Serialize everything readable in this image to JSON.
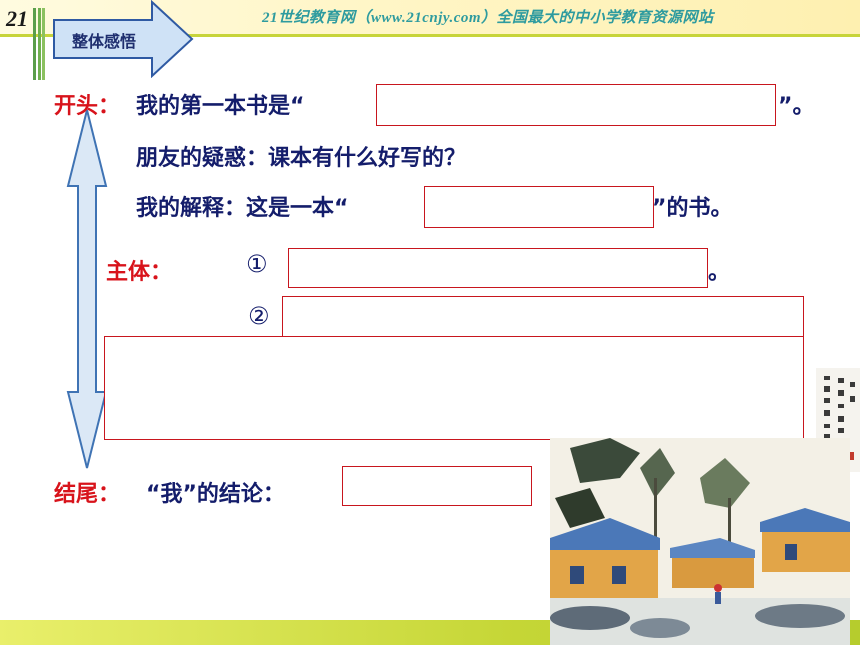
{
  "header": {
    "site_title": "21世纪教育网（www.21cnjy.com）全国最大的中小学教育资源网站",
    "logo_text": "21",
    "section_tab": "整体感悟"
  },
  "opening": {
    "label": "开头：",
    "line1_prefix": "我的第一本书是“",
    "line1_suffix": "”。",
    "line2": "朋友的疑惑：课本有什么好写的？",
    "line3_prefix": "我的解释：这是一本“",
    "line3_partial": "本",
    "line3_suffix": "”的书。"
  },
  "body_section": {
    "label": "主体：",
    "item1_marker": "①",
    "item1_suffix": "。",
    "item2_marker": "②"
  },
  "ending": {
    "label": "结尾：",
    "text": "“我”的结论："
  },
  "colors": {
    "label_red": "#d8131b",
    "text_navy": "#141d6b",
    "box_border": "#c8161e",
    "arrow_fill": "#dbe8f6",
    "arrow_stroke": "#3f73b4"
  }
}
